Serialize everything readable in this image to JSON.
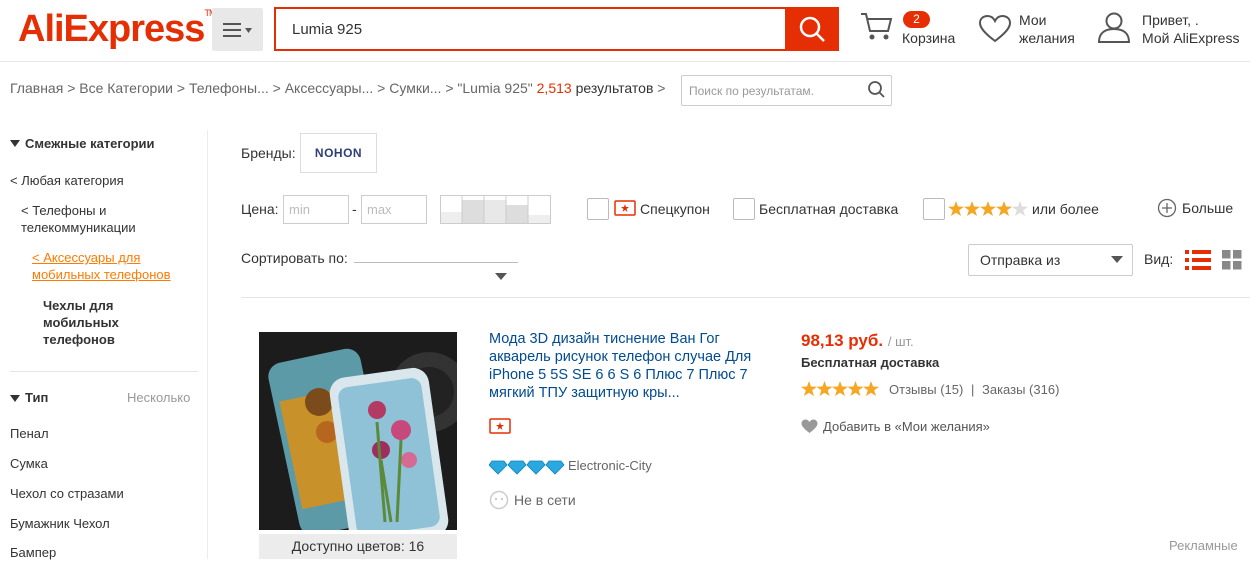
{
  "header": {
    "logo": "AliExpress",
    "search_value": "Lumia 925",
    "cart_count": "2",
    "cart_label": "Корзина",
    "wishlist_label_1": "Мои",
    "wishlist_label_2": "желания",
    "account_greeting": "Привет, .",
    "account_label": "Мой AliExpress",
    "accent_color": "#e62e04"
  },
  "breadcrumb": {
    "items": [
      "Главная",
      "Все Категории",
      "Телефоны...",
      "Аксессуары...",
      "Сумки...",
      "\"Lumia 925\""
    ],
    "separator": ">",
    "count": "2,513",
    "results_label": "результатов",
    "refine_placeholder": "Поиск по результатам."
  },
  "sidebar": {
    "related_title": "Смежные категории",
    "any_category": "< Любая категория",
    "phones_1": "< Телефоны и",
    "phones_2": "телекоммуникации",
    "accessories_1": "< Аксессуары для",
    "accessories_2": "мобильных телефонов",
    "cases_1": "Чехлы для",
    "cases_2": "мобильных",
    "cases_3": "телефонов",
    "type_title": "Тип",
    "type_multi": "Несколько",
    "type_items": [
      "Пенал",
      "Сумка",
      "Чехол со стразами",
      "Бумажник Чехол",
      "Бампер"
    ]
  },
  "filters": {
    "brands_label": "Бренды:",
    "brand_name": "NOHON",
    "price_label": "Цена:",
    "min_placeholder": "min",
    "max_placeholder": "max",
    "price_dash": "-",
    "coupon_label": "Спецкупон",
    "free_shipping_label": "Бесплатная доставка",
    "rating_label": "или более",
    "more_label": "Больше",
    "sort_label": "Сортировать по:",
    "ship_from_label": "Отправка из",
    "view_label": "Вид:"
  },
  "product": {
    "title": "Мода 3D дизайн тиснение Ван Гог акварель рисунок телефон случае Для iPhone 5 5S SE 6 6 S 6 Плюс 7 Плюс 7 мягкий ТПУ защитную кры...",
    "colors_available": "Доступно цветов: 16",
    "price": "98,13 руб.",
    "price_unit": "/ шт.",
    "shipping": "Бесплатная доставка",
    "rating": 5,
    "reviews": "Отзывы (15)",
    "divider": "|",
    "orders": "Заказы (316)",
    "wishlist": "Добавить в «Мои желания»",
    "store": "Electronic-City",
    "status": "Не в сети",
    "ad_label": "Рекламные"
  }
}
